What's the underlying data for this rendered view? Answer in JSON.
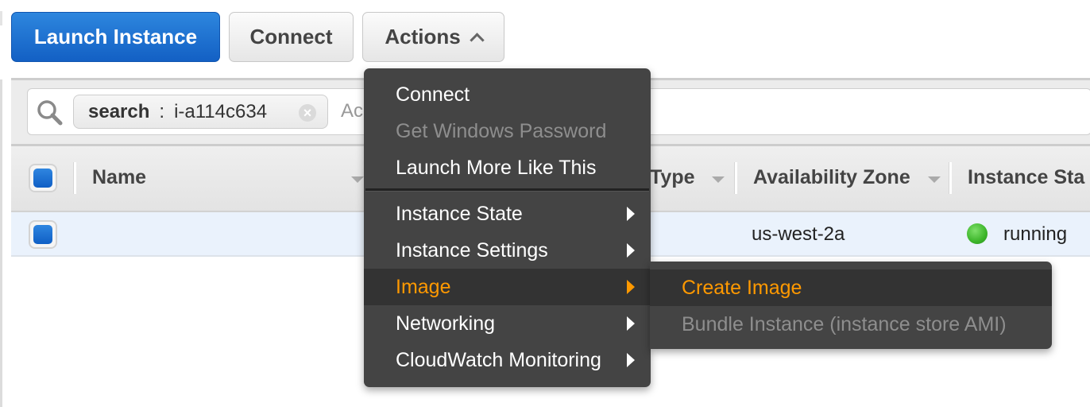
{
  "toolbar": {
    "launch_label": "Launch Instance",
    "connect_label": "Connect",
    "actions_label": "Actions"
  },
  "filter": {
    "token_key": "search",
    "token_separator": ":",
    "token_value": "i-a114c634",
    "placeholder": "Ac"
  },
  "table": {
    "columns": [
      {
        "label": "Name"
      },
      {
        "label": "Type"
      },
      {
        "label": "Availability Zone"
      },
      {
        "label": "Instance Sta"
      }
    ],
    "rows": [
      {
        "name": "",
        "availability_zone": "us-west-2a",
        "instance_state": "running",
        "state_color": "#3cb52a"
      }
    ]
  },
  "actions_menu": {
    "items": [
      {
        "label": "Connect",
        "enabled": true
      },
      {
        "label": "Get Windows Password",
        "enabled": false
      },
      {
        "label": "Launch More Like This",
        "enabled": true
      },
      {
        "label": "Instance State",
        "submenu": true
      },
      {
        "label": "Instance Settings",
        "submenu": true
      },
      {
        "label": "Image",
        "submenu": true,
        "active": true
      },
      {
        "label": "Networking",
        "submenu": true
      },
      {
        "label": "CloudWatch Monitoring",
        "submenu": true
      }
    ],
    "image_submenu": [
      {
        "label": "Create Image",
        "enabled": true,
        "highlighted": true
      },
      {
        "label": "Bundle Instance (instance store AMI)",
        "enabled": false
      }
    ]
  },
  "colors": {
    "primary": "#1a6fd0",
    "menu_bg": "#444444",
    "highlight": "#ff9900"
  }
}
